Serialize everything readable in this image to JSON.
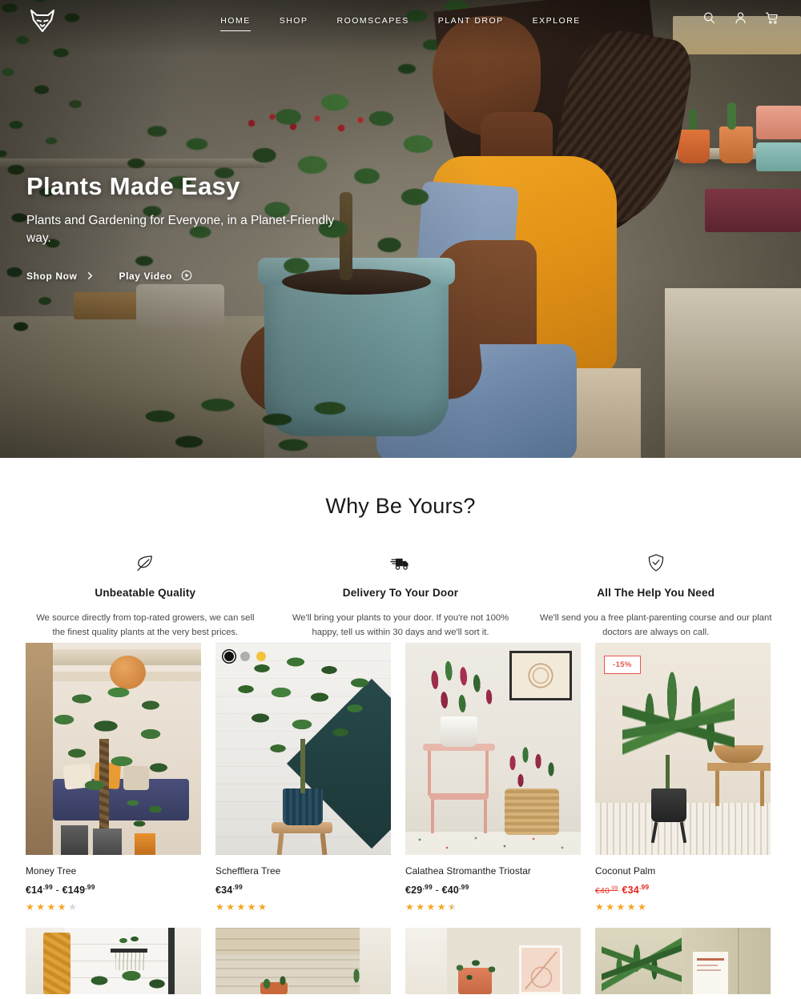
{
  "header": {
    "logo_name": "fox-head-logo",
    "nav": [
      {
        "label": "HOME",
        "active": true
      },
      {
        "label": "SHOP",
        "active": false
      },
      {
        "label": "ROOMSCAPES",
        "active": false
      },
      {
        "label": "PLANT DROP",
        "active": false
      },
      {
        "label": "EXPLORE",
        "active": false
      }
    ],
    "icons": [
      {
        "name": "search-icon"
      },
      {
        "name": "account-icon"
      },
      {
        "name": "cart-icon"
      }
    ]
  },
  "hero": {
    "title": "Plants Made Easy",
    "subtitle": "Plants and Gardening for Everyone, in a Planet-Friendly way.",
    "cta_primary": "Shop Now",
    "cta_secondary": "Play Video"
  },
  "features_section": {
    "title": "Why Be Yours?",
    "items": [
      {
        "icon": "leaf-icon",
        "title": "Unbeatable Quality",
        "text": "We source directly from top-rated growers, we can sell the finest quality plants at the very best prices."
      },
      {
        "icon": "delivery-truck-icon",
        "title": "Delivery To Your Door",
        "text": "We'll bring your plants to your door. If you're not 100% happy, tell us within 30 days and we'll sort it."
      },
      {
        "icon": "shield-check-icon",
        "title": "All The Help You Need",
        "text": "We'll send you a free plant-parenting course and our plant doctors are always on call."
      }
    ]
  },
  "products": {
    "row1": [
      {
        "name": "Money Tree",
        "price_from": "€14",
        "price_from_cents": ".99",
        "price_dash": " - ",
        "price_to": "€149",
        "price_to_cents": ".99",
        "rating": 4,
        "rating_text": "4 out of 5",
        "swatches": [],
        "badge": null
      },
      {
        "name": "Schefflera Tree",
        "price_from": "€34",
        "price_from_cents": ".99",
        "price_dash": "",
        "price_to": "",
        "price_to_cents": "",
        "rating": 5,
        "rating_text": "5 out of 5",
        "swatches": [
          {
            "name": "swatch-black",
            "color": "#111111",
            "selected": true
          },
          {
            "name": "swatch-grey",
            "color": "#aeaeae",
            "selected": false
          },
          {
            "name": "swatch-yellow",
            "color": "#f2c33c",
            "selected": false
          }
        ],
        "badge": null
      },
      {
        "name": "Calathea Stromanthe Triostar",
        "price_from": "€29",
        "price_from_cents": ".99",
        "price_dash": " - ",
        "price_to": "€40",
        "price_to_cents": ".99",
        "rating": 4.5,
        "rating_text": "4.5 out of 5",
        "swatches": [],
        "badge": null
      },
      {
        "name": "Coconut Palm",
        "price_old": "€40",
        "price_old_cents": ".99",
        "price_new": "€34",
        "price_new_cents": ".99",
        "rating": 5,
        "rating_text": "5 out of 5",
        "swatches": [],
        "badge": "-15%"
      }
    ]
  },
  "colors": {
    "accent_star": "#f5a623",
    "sale_red": "#e8241c",
    "badge_red": "#e8574a",
    "text_dark": "#1a1a1a",
    "text_muted": "#4a4a4a"
  }
}
